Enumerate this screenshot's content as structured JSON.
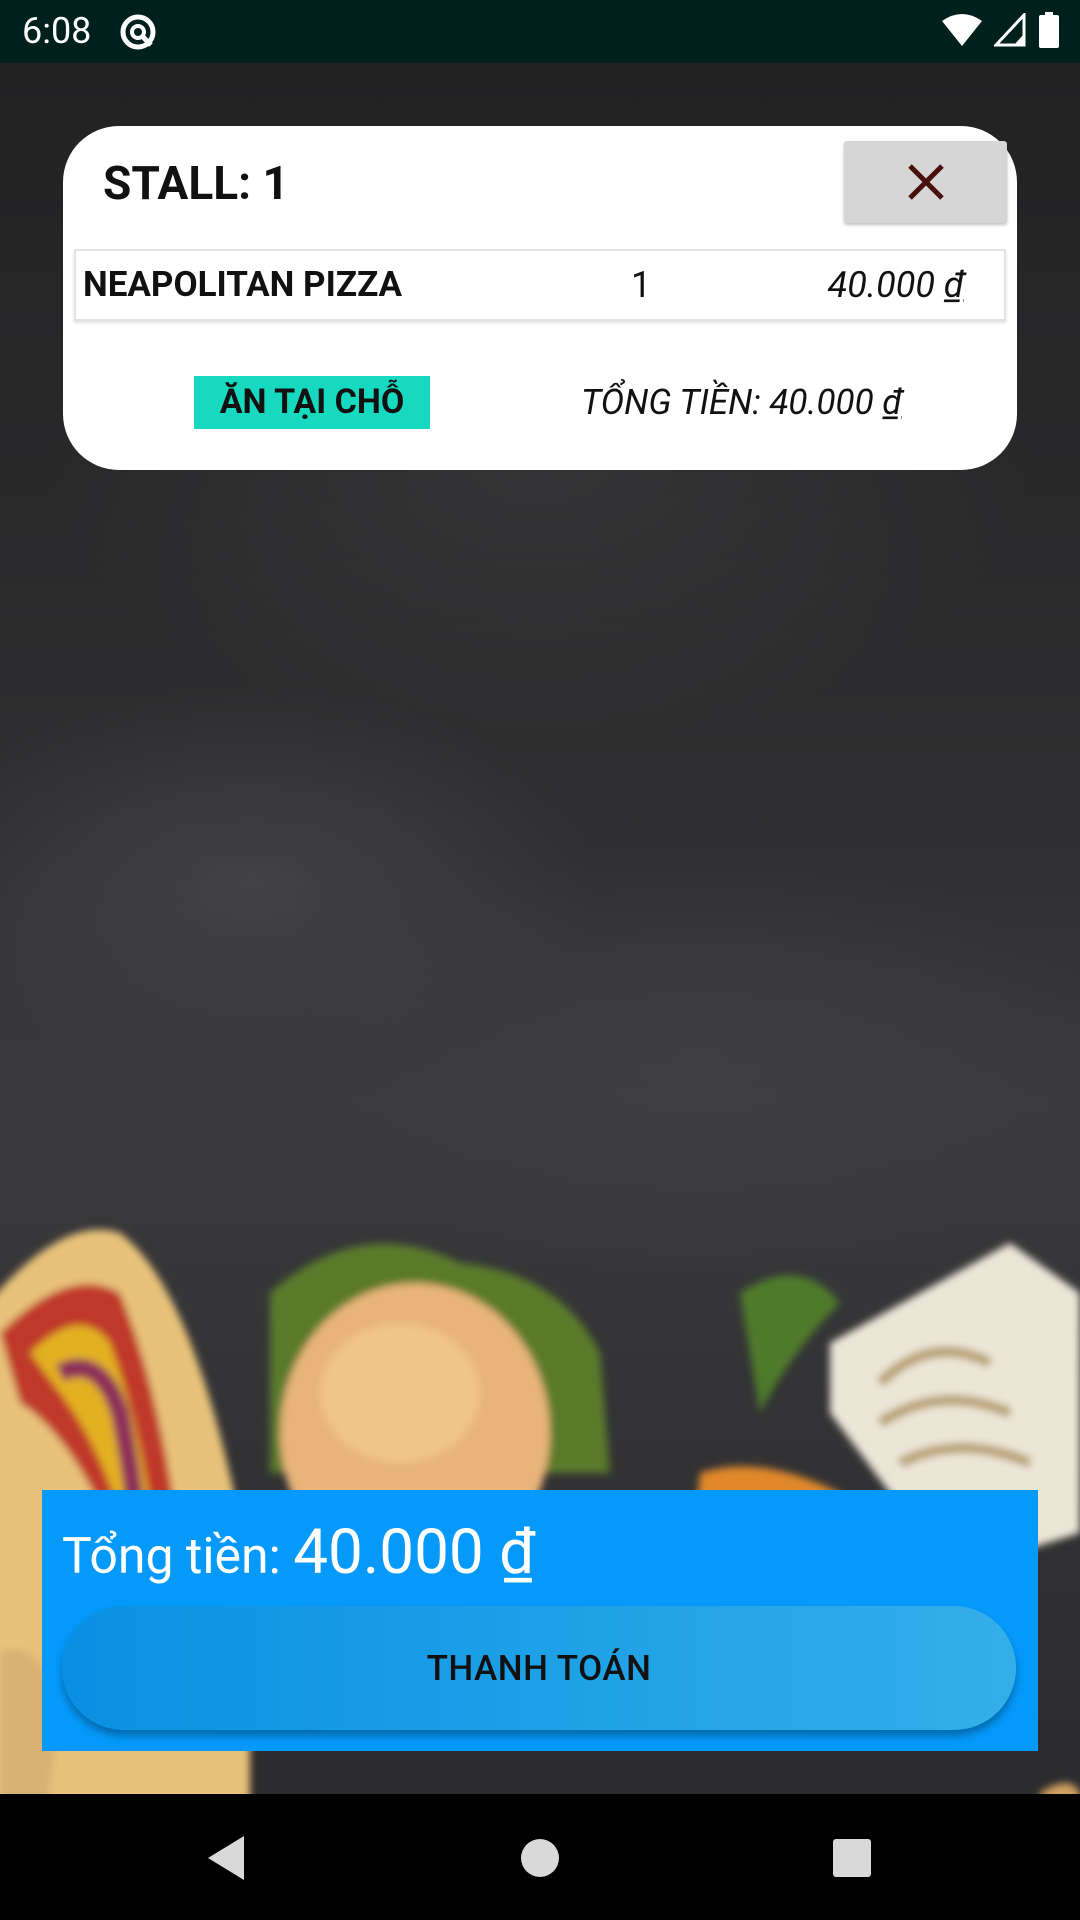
{
  "status_bar": {
    "time": "6:08",
    "icons": [
      "wifi-icon",
      "cellular-signal-icon",
      "battery-icon"
    ]
  },
  "stall_card": {
    "title": "STALL: 1",
    "item": {
      "name": "NEAPOLITAN PIZZA",
      "quantity": "1",
      "price": "40.000",
      "currency": "₫"
    },
    "badge": "ĂN TẠI CHỖ",
    "total_label": "TỔNG TIỀN: 40.000",
    "total_currency": "₫"
  },
  "checkout": {
    "total_label": "Tổng tiền: ",
    "total_value": "40.000",
    "currency": "₫",
    "pay_label": "THANH TOÁN"
  },
  "colors": {
    "status_bar_bg": "#00201c",
    "badge_bg": "#17d9c0",
    "checkout_bg": "#0599fa",
    "close_button_bg": "#d6d6d6"
  }
}
